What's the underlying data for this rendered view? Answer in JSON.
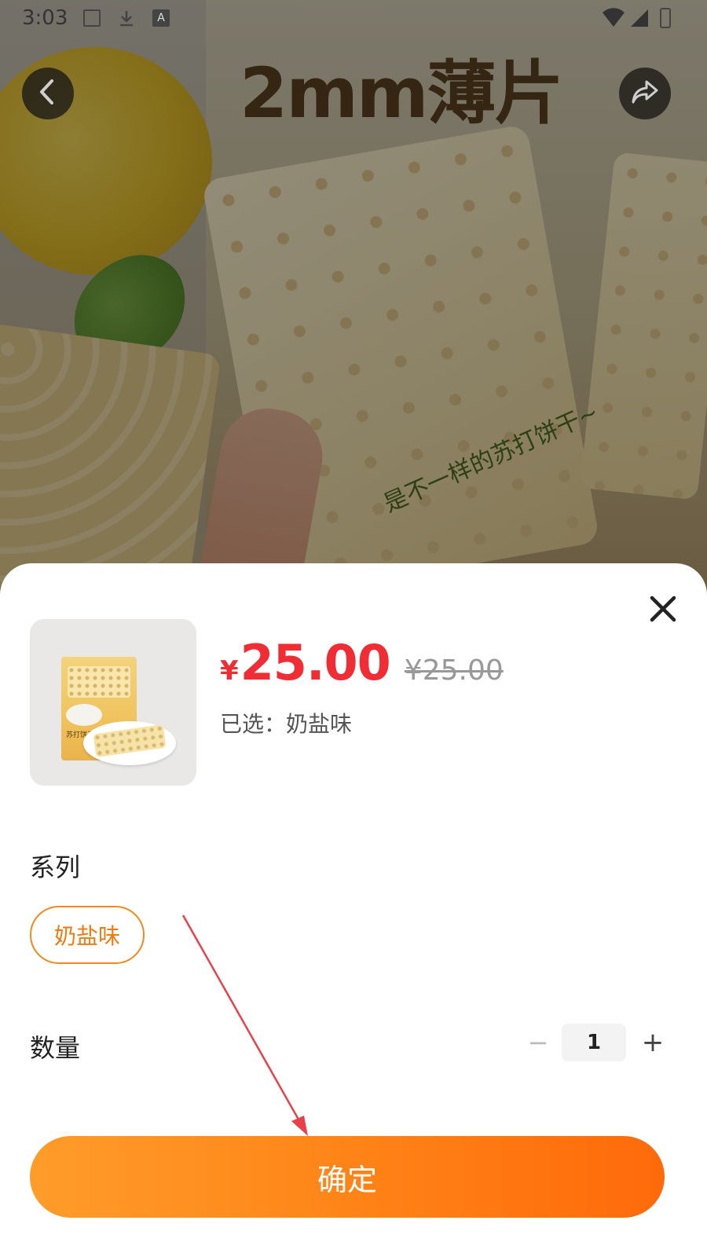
{
  "status_bar": {
    "time": "3:03",
    "icons": [
      "image-icon",
      "download-icon",
      "font-icon",
      "wifi-icon",
      "signal-icon",
      "battery-icon"
    ]
  },
  "background": {
    "headline": "2mm薄片",
    "slogan": "是不一样的苏打饼干~"
  },
  "nav": {
    "back_icon": "chevron-left-icon",
    "share_icon": "share-icon"
  },
  "product": {
    "image_label": "苏打饼干",
    "price_currency": "¥",
    "price": "25.00",
    "original_price": "¥25.00",
    "selected_text": "已选：奶盐味"
  },
  "options": {
    "series_title": "系列",
    "series_items": [
      "奶盐味"
    ],
    "selected_index": 0,
    "quantity_title": "数量",
    "quantity_minus": "−",
    "quantity_value": "1",
    "quantity_plus": "+"
  },
  "confirm_label": "确定",
  "colors": {
    "price": "#f02d35",
    "accent": "#f08a1c",
    "button_gradient_start": "#ff9c2a",
    "button_gradient_end": "#ff6a0a",
    "annotation_arrow": "#e8414b"
  }
}
